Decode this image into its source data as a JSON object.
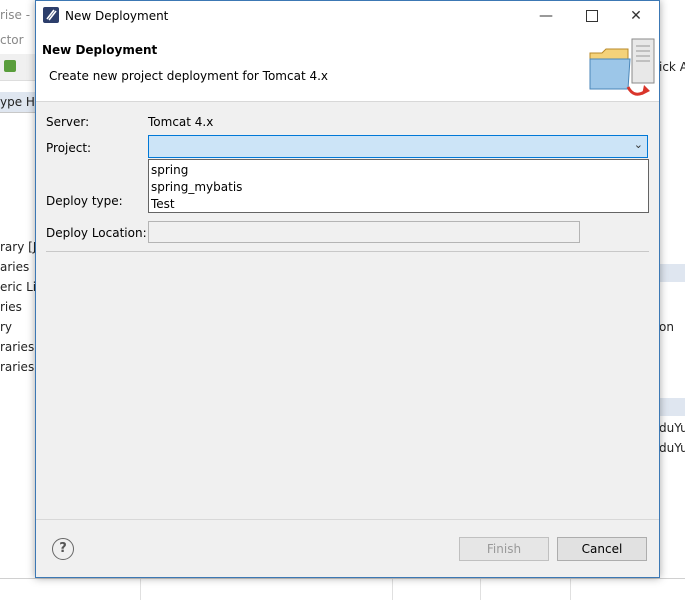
{
  "background": {
    "left_fragments": [
      "rise -",
      "ctor",
      "ype Hi",
      "rary [J",
      "aries",
      "eric Li",
      "ries",
      "ry",
      "raries",
      "raries"
    ],
    "right_fragments": [
      "ick A",
      "on",
      "duYu",
      "duYu"
    ]
  },
  "dialog": {
    "title": "New Deployment",
    "header": {
      "title": "New Deployment",
      "description": "Create new project deployment for Tomcat  4.x"
    },
    "form": {
      "server_label": "Server:",
      "server_value": "Tomcat  4.x",
      "project_label": "Project:",
      "project_value": "",
      "project_options": [
        "spring",
        "spring_mybatis",
        "Test"
      ],
      "deploy_type_label": "Deploy type:",
      "deploy_location_label": "Deploy Location:",
      "deploy_location_value": ""
    },
    "buttons": {
      "finish": "Finish",
      "cancel": "Cancel",
      "help": "?"
    }
  }
}
